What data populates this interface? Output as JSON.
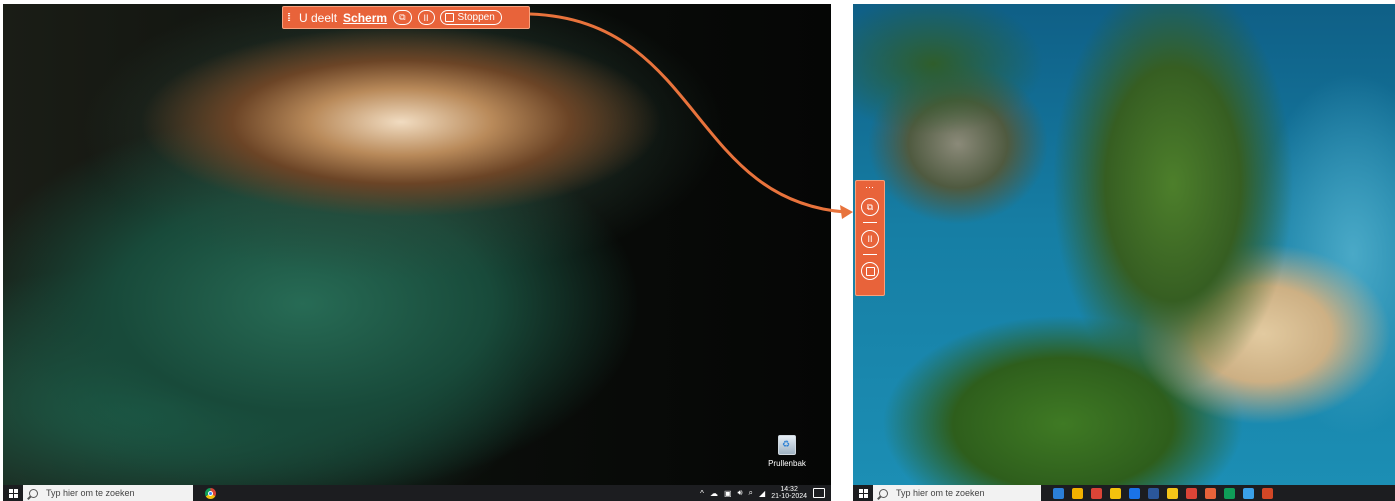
{
  "share_bar": {
    "sharing_label": "U deelt",
    "screen_link": "Scherm",
    "pause_label": "II",
    "stop_label": "Stoppen"
  },
  "side_bar": {
    "pause_label": "II"
  },
  "left_desktop": {
    "recycle_bin_label": "Prullenbak",
    "search_placeholder": "Typ hier om te zoeken",
    "clock_time": "14:32",
    "clock_date": "21-10-2024"
  },
  "right_desktop": {
    "search_placeholder": "Typ hier om te zoeken",
    "taskbar_apps": [
      {
        "name": "mail",
        "color": "#2b7fd8"
      },
      {
        "name": "store",
        "color": "#f2b100"
      },
      {
        "name": "chrome",
        "color": "#db4437"
      },
      {
        "name": "explorer",
        "color": "#f4c20d"
      },
      {
        "name": "chrome-profile",
        "color": "#1a73e8"
      },
      {
        "name": "word",
        "color": "#2b579a"
      },
      {
        "name": "norton",
        "color": "#f5c518"
      },
      {
        "name": "chrome-2",
        "color": "#db4437"
      },
      {
        "name": "teams-active",
        "color": "#e8633a"
      },
      {
        "name": "chrome-3",
        "color": "#0f9d58"
      },
      {
        "name": "photos",
        "color": "#3aa0e8"
      },
      {
        "name": "powerpoint",
        "color": "#d24726"
      }
    ]
  },
  "colors": {
    "accent": "#e8633a",
    "taskbar": "#1c1d20",
    "arrow": "#e8733c"
  }
}
